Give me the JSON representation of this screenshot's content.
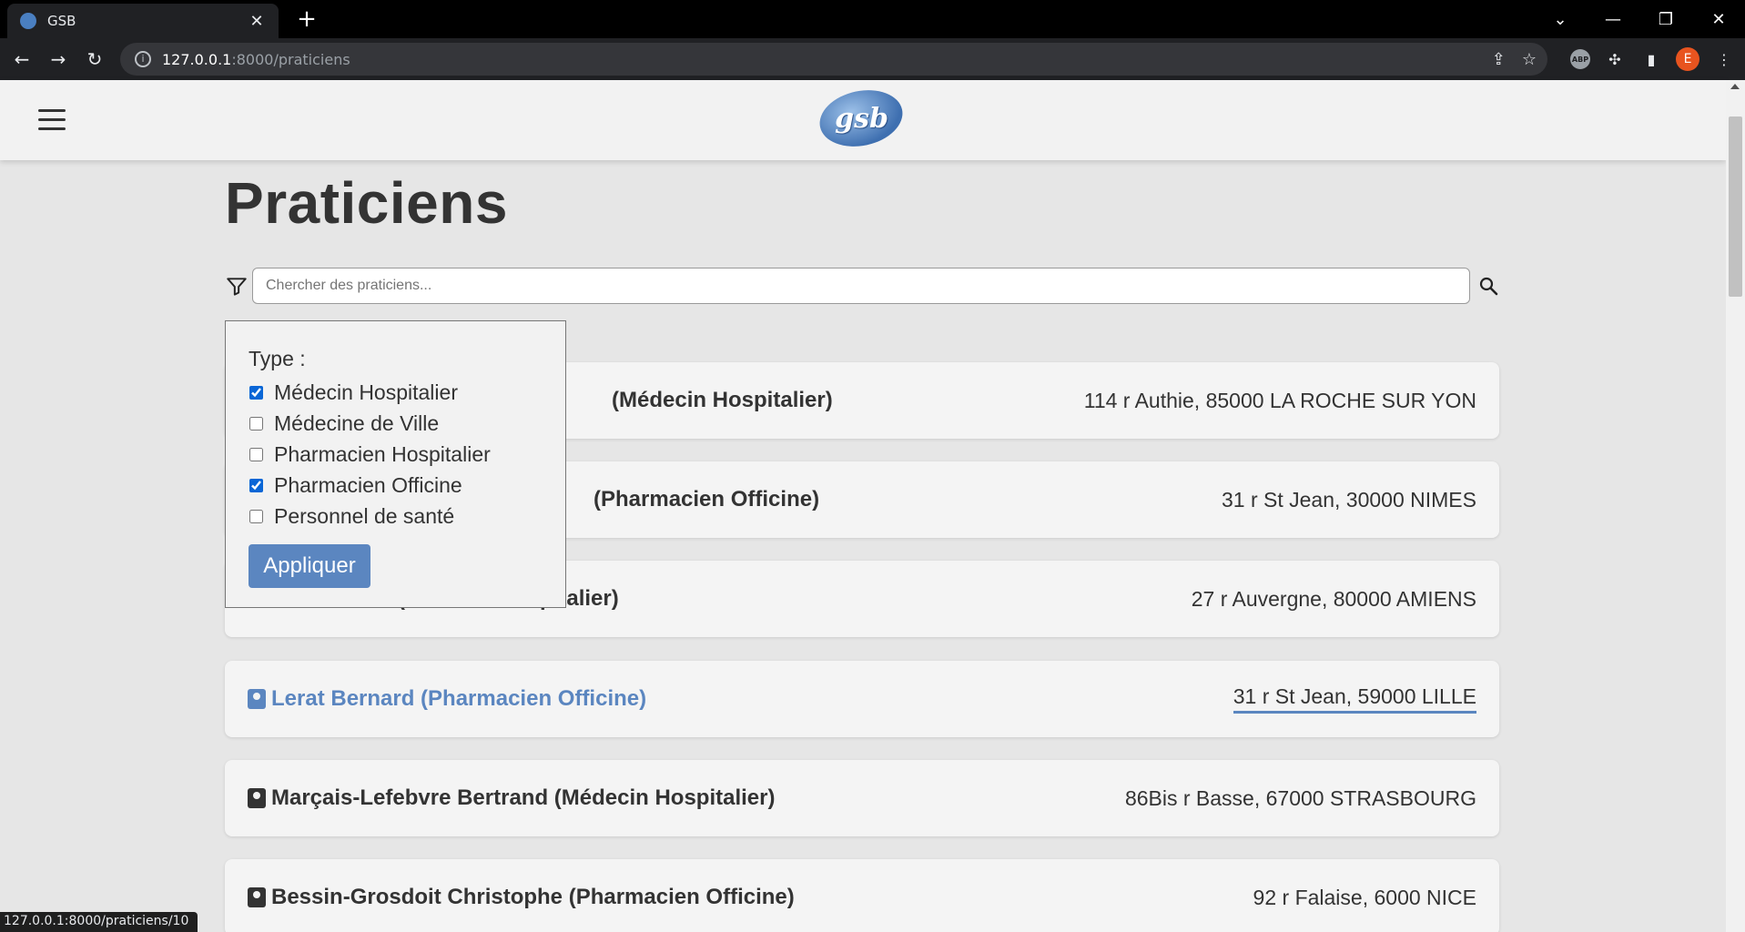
{
  "browser": {
    "tab_title": "GSB",
    "url_host": "127.0.0.1",
    "url_rest": ":8000/praticiens",
    "profile_initial": "E",
    "extension_label": "ABP",
    "status_url": "127.0.0.1:8000/praticiens/10"
  },
  "header": {
    "logo_text": "gsb"
  },
  "page": {
    "title": "Praticiens",
    "search_placeholder": "Chercher des praticiens..."
  },
  "filter": {
    "label": "Type :",
    "options": [
      {
        "label": "Médecin Hospitalier",
        "checked": true
      },
      {
        "label": "Médecine de Ville",
        "checked": false
      },
      {
        "label": "Pharmacien Hospitalier",
        "checked": false
      },
      {
        "label": "Pharmacien Officine",
        "checked": true
      },
      {
        "label": "Personnel de santé",
        "checked": false
      }
    ],
    "apply_label": "Appliquer"
  },
  "praticiens": [
    {
      "name": "(Médecin Hospitalier)",
      "address": "114 r Authie, 85000 LA ROCHE SUR YON"
    },
    {
      "name": "(Pharmacien Officine)",
      "address": "31 r St Jean, 30000 NIMES"
    },
    {
      "name": "(Médecin Hospitalier)",
      "address": "27 r Auvergne, 80000 AMIENS"
    },
    {
      "name": "Lerat Bernard (Pharmacien Officine)",
      "address": "31 r St Jean, 59000 LILLE"
    },
    {
      "name": "Marçais-Lefebvre Bertrand (Médecin Hospitalier)",
      "address": "86Bis r Basse, 67000 STRASBOURG"
    },
    {
      "name": "Bessin-Grosdoit Christophe (Pharmacien Officine)",
      "address": "92 r Falaise, 6000 NICE"
    }
  ]
}
